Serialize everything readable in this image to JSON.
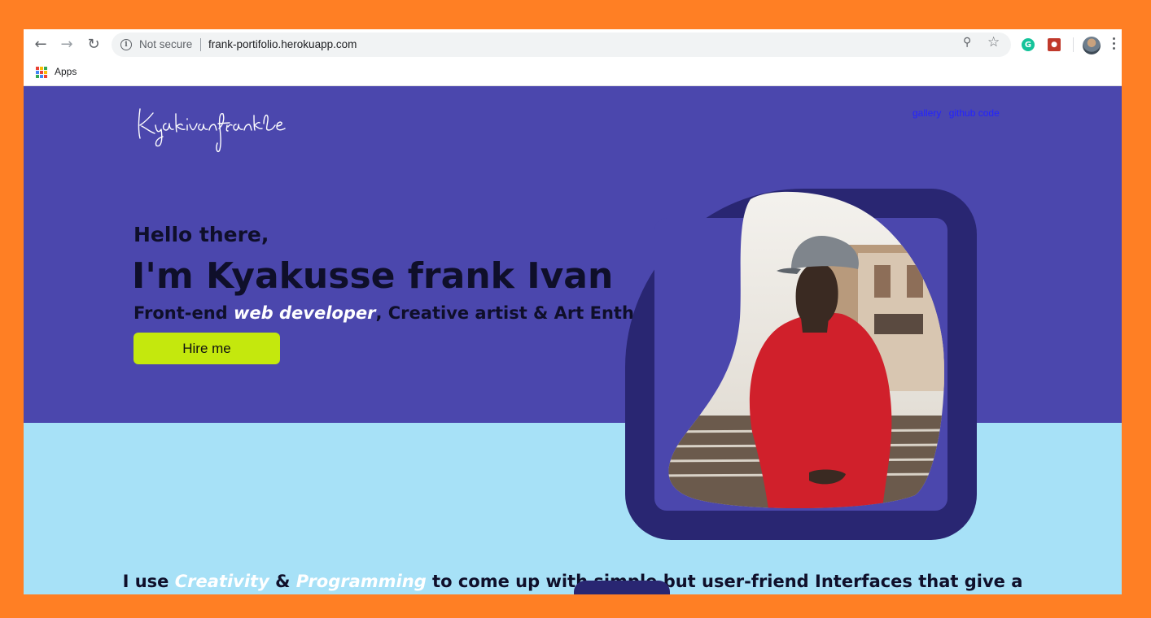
{
  "browser": {
    "security_label": "Not secure",
    "url": "frank-portifolio.herokuapp.com",
    "bookmarks": {
      "apps_label": "Apps"
    },
    "icons": [
      "back-icon",
      "forward-icon",
      "reload-icon",
      "info-icon",
      "zoom-icon",
      "star-icon",
      "grammarly-icon",
      "extension-icon",
      "profile-avatar",
      "menu-icon"
    ]
  },
  "site": {
    "logo_text": "Kyakivanfrank",
    "nav": [
      {
        "label": "gallery"
      },
      {
        "label": "github code"
      }
    ],
    "hero": {
      "greeting": "Hello there,",
      "name": "I'm Kyakusse frank Ivan",
      "tagline": {
        "part1": "Front-end ",
        "highlight": "web developer",
        "part2": ", Creative artist & Art Enthusiast"
      },
      "cta_label": "Hire me"
    },
    "intro": {
      "part1": "I use ",
      "highlight1": "Creativity",
      "part2": " & ",
      "highlight2": "Programming",
      "part3": " to come up with simple but user-friend Interfaces that give a"
    },
    "colors": {
      "frame_orange": "#ff7f24",
      "hero_bg": "#4b47ad",
      "lower_bg": "#a7e1f7",
      "frame_dark": "#292672",
      "cta_bg": "#c4e80d",
      "nav_link": "#2323ff",
      "text_dark": "#0f0f2a"
    }
  }
}
